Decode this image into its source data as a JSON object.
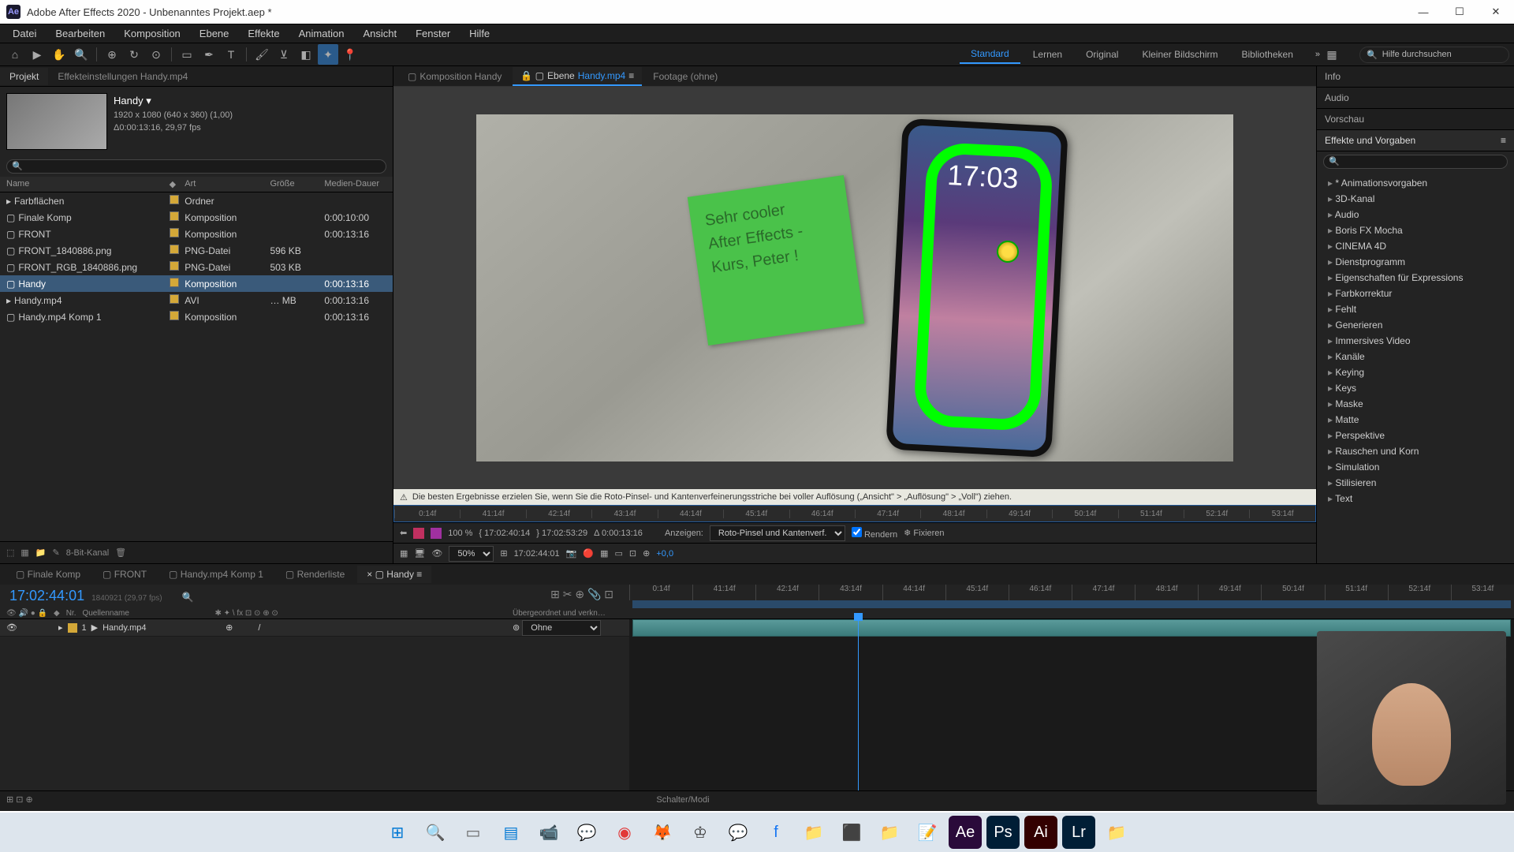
{
  "title": "Adobe After Effects 2020 - Unbenanntes Projekt.aep *",
  "app_icon": "Ae",
  "menu": [
    "Datei",
    "Bearbeiten",
    "Komposition",
    "Ebene",
    "Effekte",
    "Animation",
    "Ansicht",
    "Fenster",
    "Hilfe"
  ],
  "workspaces": [
    "Standard",
    "Lernen",
    "Original",
    "Kleiner Bildschirm",
    "Bibliotheken"
  ],
  "search_help_placeholder": "Hilfe durchsuchen",
  "project": {
    "tab_project": "Projekt",
    "tab_effect": "Effekteinstellungen  Handy.mp4",
    "comp_name": "Handy ▾",
    "meta1": "1920 x 1080 (640 x 360) (1,00)",
    "meta2": "Δ0:00:13:16, 29,97 fps",
    "col_name": "Name",
    "col_type": "Art",
    "col_size": "Größe",
    "col_dur": "Medien-Dauer",
    "items": [
      {
        "icon": "▸",
        "name": "Farbflächen",
        "type": "Ordner",
        "size": "",
        "dur": ""
      },
      {
        "icon": "▢",
        "name": "Finale Komp",
        "type": "Komposition",
        "size": "",
        "dur": "0:00:10:00"
      },
      {
        "icon": "▢",
        "name": "FRONT",
        "type": "Komposition",
        "size": "",
        "dur": "0:00:13:16"
      },
      {
        "icon": "▢",
        "name": "FRONT_1840886.png",
        "type": "PNG-Datei",
        "size": "596 KB",
        "dur": ""
      },
      {
        "icon": "▢",
        "name": "FRONT_RGB_1840886.png",
        "type": "PNG-Datei",
        "size": "503 KB",
        "dur": ""
      },
      {
        "icon": "▢",
        "name": "Handy",
        "type": "Komposition",
        "size": "",
        "dur": "0:00:13:16",
        "sel": true
      },
      {
        "icon": "▸",
        "name": "Handy.mp4",
        "type": "AVI",
        "size": "… MB",
        "dur": "0:00:13:16"
      },
      {
        "icon": "▢",
        "name": "Handy.mp4 Komp 1",
        "type": "Komposition",
        "size": "",
        "dur": "0:00:13:16"
      }
    ],
    "footer": "8-Bit-Kanal"
  },
  "viewer": {
    "tab_comp": "Komposition  Handy",
    "tab_layer_prefix": "Ebene  ",
    "tab_layer_name": "Handy.mp4",
    "tab_footage": "Footage  (ohne)",
    "note_line1": "Sehr cooler",
    "note_line2": "After Effects -",
    "note_line3": "Kurs, Peter !",
    "phone_time": "17:03",
    "warning": "Die besten Ergebnisse erzielen Sie, wenn Sie die Roto-Pinsel- und Kantenverfeinerungsstriche bei voller Auflösung („Ansicht\" > „Auflösung\" > „Voll\") ziehen.",
    "mini_ticks": [
      "0:14f",
      "41:14f",
      "42:14f",
      "43:14f",
      "44:14f",
      "45:14f",
      "46:14f",
      "47:14f",
      "48:14f",
      "49:14f",
      "50:14f",
      "51:14f",
      "52:14f",
      "53:14f"
    ],
    "rt_in": "17:02:40:14",
    "rt_out": "17:02:53:29",
    "rt_dur": "Δ 0:00:13:16",
    "rt_show_label": "Anzeigen:",
    "rt_show_val": "Roto-Pinsel und Kantenverf.",
    "rt_render": "Rendern",
    "rt_freeze": "Fixieren",
    "zoom": "50%",
    "footer_time": "17:02:44:01",
    "footer_adj": "+0,0"
  },
  "right": {
    "sections": [
      "Info",
      "Audio",
      "Vorschau"
    ],
    "effects_title": "Effekte und Vorgaben",
    "presets": [
      "* Animationsvorgaben",
      "3D-Kanal",
      "Audio",
      "Boris FX Mocha",
      "CINEMA 4D",
      "Dienstprogramm",
      "Eigenschaften für Expressions",
      "Farbkorrektur",
      "Fehlt",
      "Generieren",
      "Immersives Video",
      "Kanäle",
      "Keying",
      "Keys",
      "Maske",
      "Matte",
      "Perspektive",
      "Rauschen und Korn",
      "Simulation",
      "Stilisieren",
      "Text"
    ]
  },
  "timeline": {
    "tabs": [
      "Finale Komp",
      "FRONT",
      "Handy.mp4 Komp 1",
      "Renderliste",
      "Handy"
    ],
    "active_tab": 4,
    "timecode": "17:02:44:01",
    "sub": "1840921 (29,97 fps)",
    "head_nr": "Nr.",
    "head_src": "Quellenname",
    "head_parent": "Übergeordnet und verkn…",
    "layer_num": "1",
    "layer_name": "Handy.mp4",
    "parent_val": "Ohne",
    "ruler": [
      "0:14f",
      "41:14f",
      "42:14f",
      "43:14f",
      "44:14f",
      "45:14f",
      "46:14f",
      "47:14f",
      "48:14f",
      "49:14f",
      "50:14f",
      "51:14f",
      "52:14f",
      "53:14f"
    ],
    "footer_label": "Schalter/Modi"
  },
  "taskbar_icons": [
    "⊞",
    "🔍",
    "▭",
    "▤",
    "📹",
    "💬",
    "◉",
    "🦊",
    "♔",
    "💬",
    "f",
    "📁",
    "⬛",
    "📁",
    "📝",
    "Ae",
    "Ps",
    "Ai",
    "Lr",
    "📁"
  ]
}
